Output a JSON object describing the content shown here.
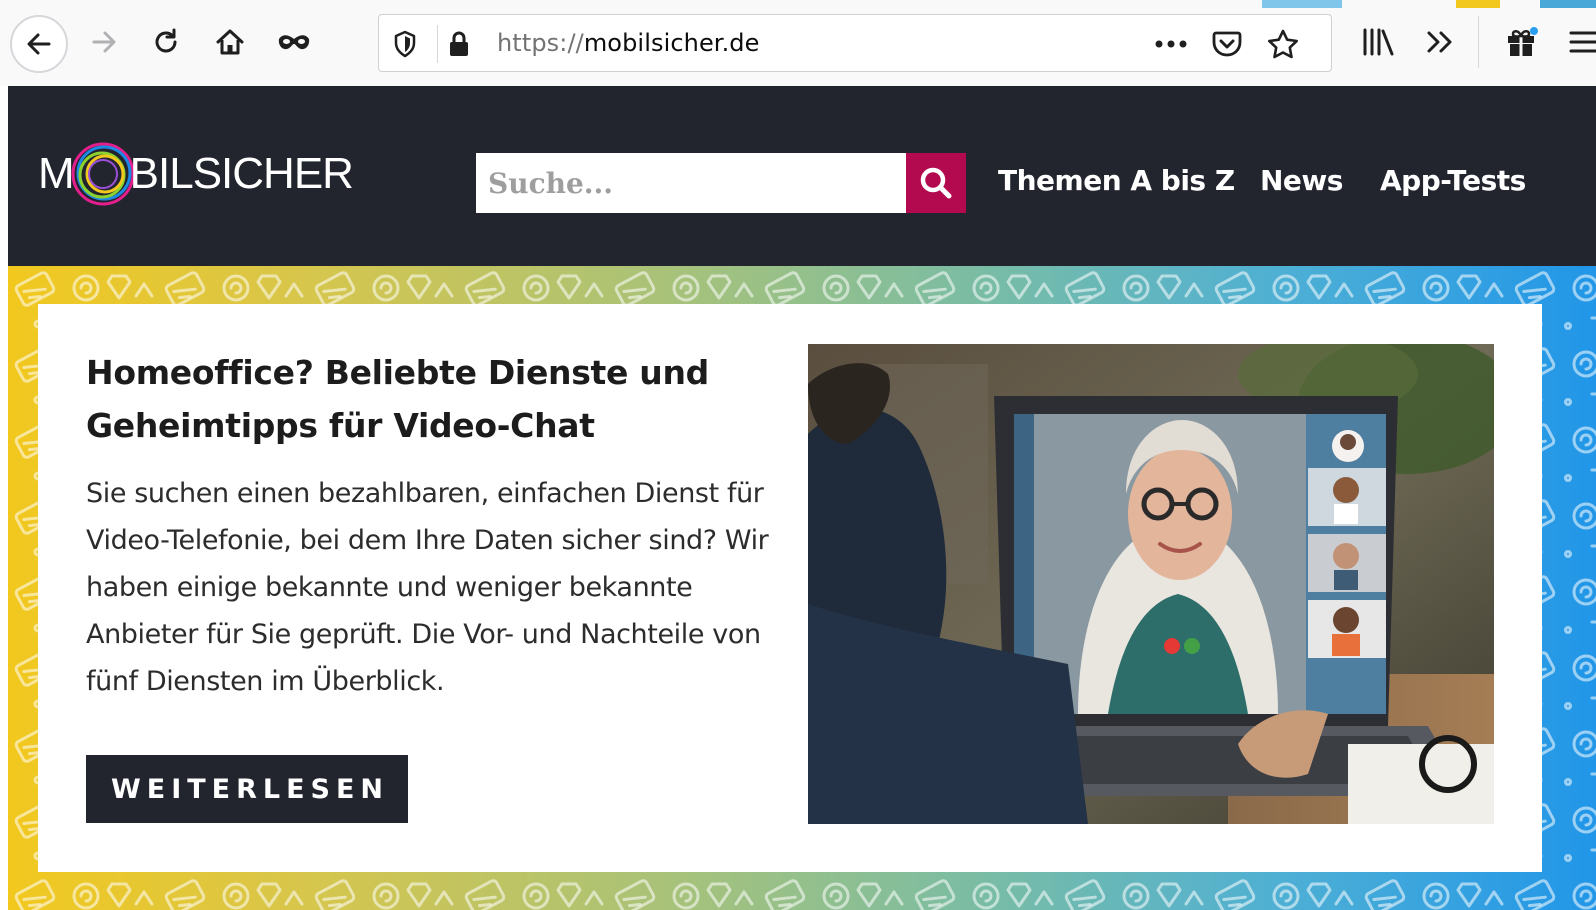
{
  "browser": {
    "url_scheme": "https://",
    "url_host": "mobilsicher.de",
    "icons": {
      "back": "back-arrow-icon",
      "forward": "forward-arrow-icon",
      "reload": "reload-icon",
      "home": "home-icon",
      "private": "mask-icon",
      "tracking_protection": "shield-icon",
      "secure": "lock-icon",
      "page_actions": "more-dots-icon",
      "pocket": "pocket-icon",
      "bookmark": "star-icon",
      "library": "library-icon",
      "overflow": "double-chevron-icon",
      "extension": "gift-icon",
      "menu": "hamburger-icon"
    }
  },
  "header": {
    "logo_prefix": "M",
    "logo_suffix": "BILSICHER",
    "search_placeholder": "Suche...",
    "search_icon": "search-icon",
    "nav": [
      "Themen A bis Z",
      "News",
      "App-Tests"
    ]
  },
  "hero": {
    "title": "Homeoffice? Beliebte Dienste und Geheimtipps für Video-Chat",
    "text": "Sie suchen einen bezahlbaren, einfachen Dienst für Video-Telefonie, bei dem Ihre Daten sicher sind? Wir haben einige bekannte und weniger bekannte Anbieter für Sie geprüft. Die Vor- und Nachteile von fünf Diensten im Überblick.",
    "button_label": "WEITERLESEN"
  },
  "colors": {
    "header_bg": "#22252e",
    "accent": "#b30a4f",
    "gradient_start": "#f2c81e",
    "gradient_end": "#2196e8"
  }
}
